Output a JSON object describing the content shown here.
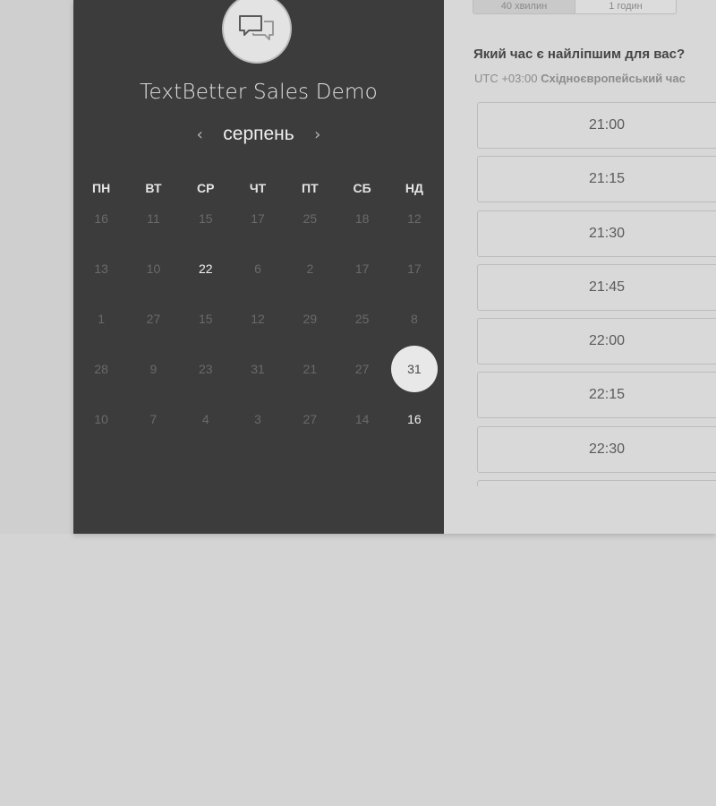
{
  "event": {
    "title": "TextBetter Sales Demo",
    "logo_icon": "chat-bubbles-icon"
  },
  "calendar": {
    "month": "серпень",
    "prev_icon": "chevron-left-icon",
    "next_icon": "chevron-right-icon",
    "weekdays": [
      "ПН",
      "ВТ",
      "СР",
      "ЧТ",
      "ПТ",
      "СБ",
      "НД"
    ],
    "weeks": [
      [
        "16",
        "11",
        "15",
        "17",
        "25",
        "18",
        "12"
      ],
      [
        "13",
        "10",
        "22",
        "6",
        "2",
        "17",
        "17"
      ],
      [
        "1",
        "27",
        "15",
        "12",
        "29",
        "25",
        "8"
      ],
      [
        "28",
        "9",
        "23",
        "31",
        "21",
        "27",
        "31"
      ],
      [
        "10",
        "7",
        "4",
        "3",
        "27",
        "14",
        "16"
      ]
    ],
    "available": [
      [
        1,
        2
      ],
      [
        4,
        6
      ]
    ],
    "selected": [
      3,
      6
    ]
  },
  "duration": {
    "options": [
      "40 хвилин",
      "1 годин"
    ],
    "selected_index": 0
  },
  "time_picker": {
    "question": "Який час є найліпшим для вас?",
    "timezone_offset": "UTC +03:00",
    "timezone_name": "Східноєвропейський час",
    "slots": [
      "21:00",
      "21:15",
      "21:30",
      "21:45",
      "22:00",
      "22:15",
      "22:30",
      ""
    ]
  },
  "colors": {
    "left_panel": "#3c3c3c",
    "right_panel": "#d8d8d8",
    "page_background": "#d4d4d4",
    "selected_day_bg": "#e8e8e8"
  }
}
